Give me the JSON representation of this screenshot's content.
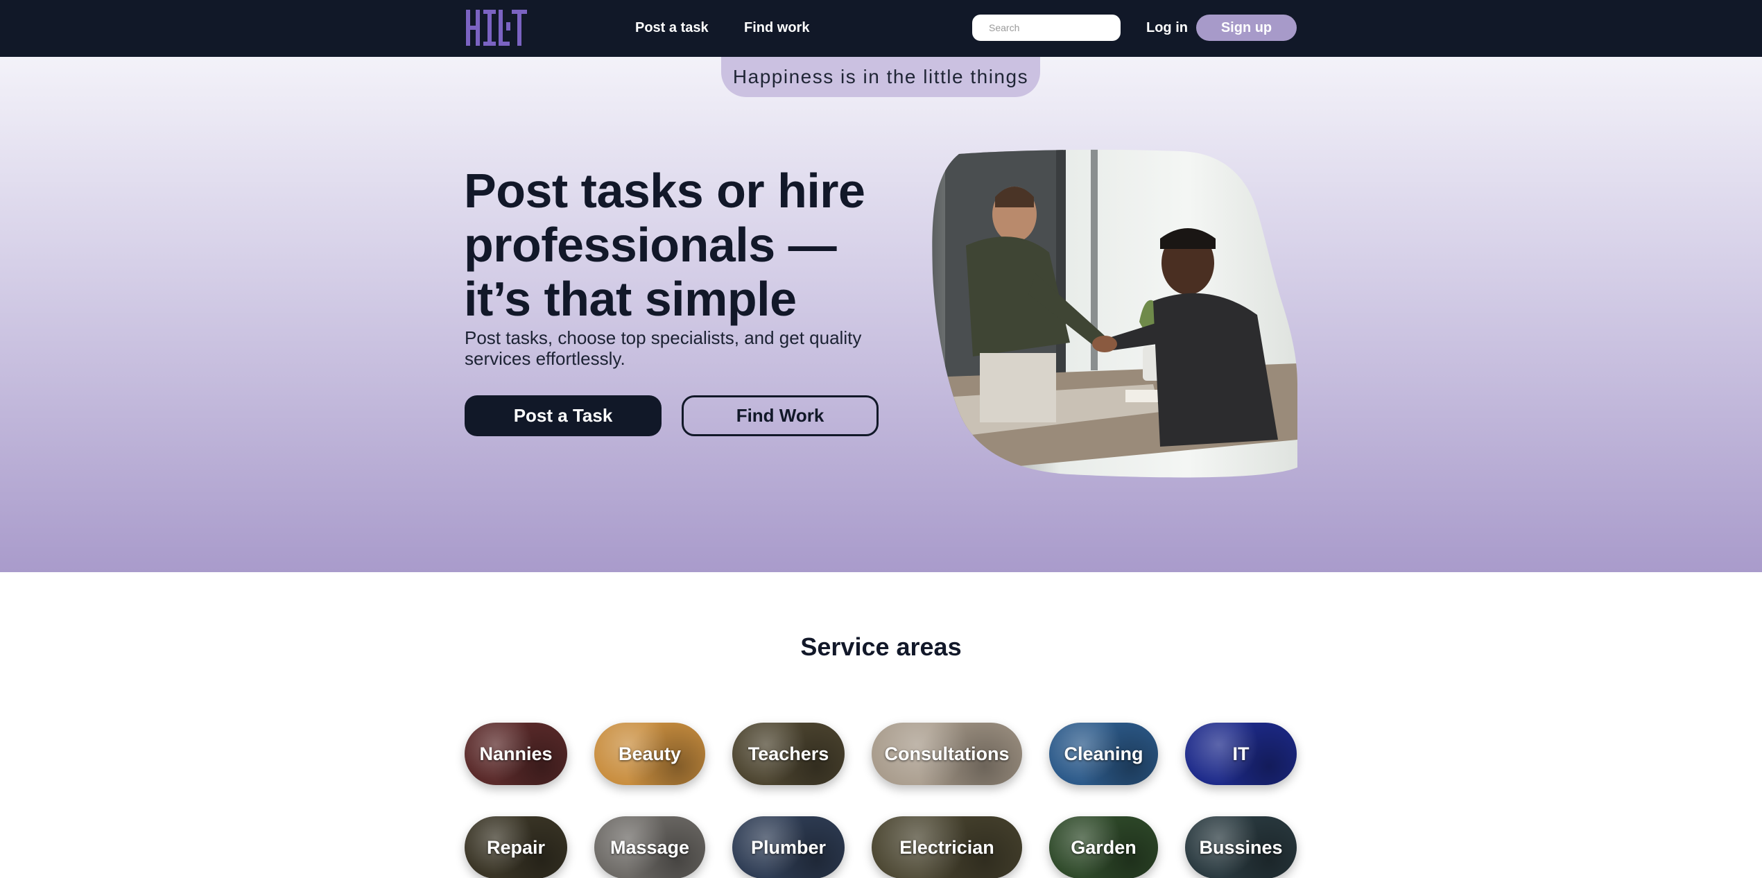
{
  "header": {
    "logo_icon": "hitlt-logo",
    "nav": {
      "post_task": "Post a task",
      "find_work": "Find work"
    },
    "search": {
      "placeholder": "Search",
      "value": ""
    },
    "login": "Log in",
    "signup": "Sign up"
  },
  "hero": {
    "tagline": "Happiness is in the little things",
    "title": "Post tasks or hire professionals — it’s that simple",
    "subtitle": "Post tasks, choose top specialists, and get quality services effortlessly.",
    "post_button": "Post a Task",
    "find_button": "Find Work",
    "image_icon": "handshake-photo"
  },
  "services": {
    "title": "Service areas",
    "items": [
      {
        "label": "Nannies",
        "color": "#5a2a2a"
      },
      {
        "label": "Beauty",
        "color": "#c98e3f"
      },
      {
        "label": "Teachers",
        "color": "#4d4530"
      },
      {
        "label": "Consultations",
        "color": "#a79a8a"
      },
      {
        "label": "Cleaning",
        "color": "#2c5a8a"
      },
      {
        "label": "IT",
        "color": "#1d2a8a"
      },
      {
        "label": "Repair",
        "color": "#3a3526"
      },
      {
        "label": "Massage",
        "color": "#6d6a66"
      },
      {
        "label": "Plumber",
        "color": "#2f3d55"
      },
      {
        "label": "Electrician",
        "color": "#4a4530"
      },
      {
        "label": "Garden",
        "color": "#2f4a2a"
      },
      {
        "label": "Bussines",
        "color": "#2a3a40"
      }
    ]
  },
  "colors": {
    "header_bg": "#111828",
    "accent": "#a79ac9",
    "hero_top": "#f3f2f9",
    "hero_bottom": "#a99bcb"
  }
}
